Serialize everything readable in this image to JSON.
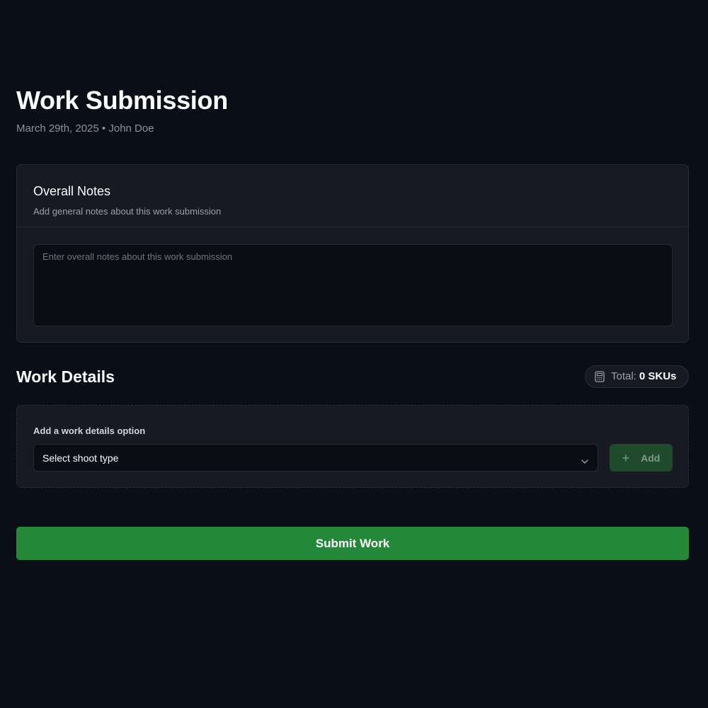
{
  "header": {
    "title": "Work Submission",
    "date": "March 29th, 2025",
    "separator": "•",
    "author": "John Doe"
  },
  "overall_notes": {
    "title": "Overall Notes",
    "description": "Add general notes about this work submission",
    "textarea_value": "",
    "textarea_placeholder": "Enter overall notes about this work submission"
  },
  "work_details": {
    "title": "Work Details",
    "total_label": "Total:",
    "total_value": "0 SKUs",
    "total_icon": "calculator-icon",
    "option_label": "Add a work details option",
    "select_value": "Select shoot type",
    "select_icon": "chevron-down-icon",
    "add_button_label": "Add",
    "add_button_icon": "plus-icon"
  },
  "actions": {
    "submit_label": "Submit Work"
  },
  "colors": {
    "background": "#0a0f17",
    "card": "#171a22",
    "accent_green": "#23883a",
    "add_button_bg": "#1f4a2b"
  }
}
